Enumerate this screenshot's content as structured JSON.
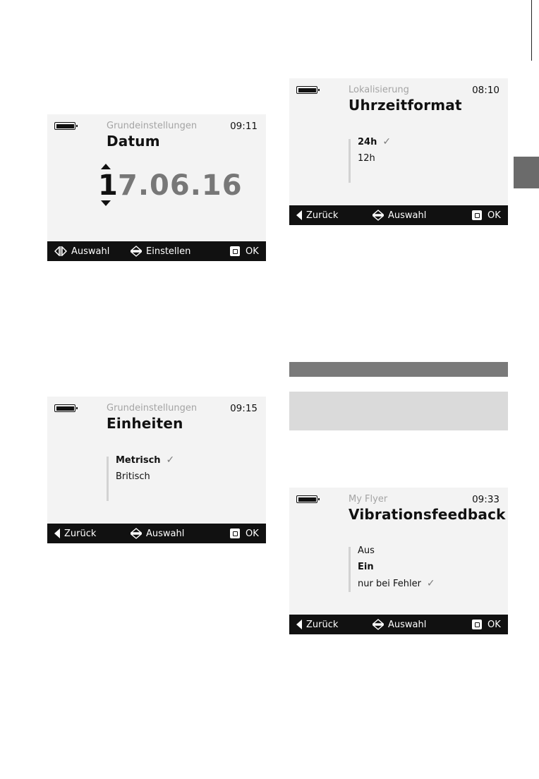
{
  "screens": [
    {
      "context": "Grundeinstellungen",
      "time": "09:11",
      "title": "Datum",
      "date": {
        "active_digit": "1",
        "rest": "7.06.16"
      },
      "footer": {
        "left": "Auswahl",
        "center": "Einstellen",
        "right": "OK"
      }
    },
    {
      "context": "Lokalisierung",
      "time": "08:10",
      "title": "Uhrzeitformat",
      "options": [
        {
          "label": "24h",
          "selected": true,
          "checked": true
        },
        {
          "label": "12h",
          "selected": false,
          "checked": false
        }
      ],
      "footer": {
        "left": "Zurück",
        "center": "Auswahl",
        "right": "OK"
      }
    },
    {
      "context": "Grundeinstellungen",
      "time": "09:15",
      "title": "Einheiten",
      "options": [
        {
          "label": "Metrisch",
          "selected": true,
          "checked": true
        },
        {
          "label": "Britisch",
          "selected": false,
          "checked": false
        }
      ],
      "footer": {
        "left": "Zurück",
        "center": "Auswahl",
        "right": "OK"
      }
    },
    {
      "context": "My Flyer",
      "time": "09:33",
      "title": "Vibrationsfeedback",
      "options": [
        {
          "label": "Aus",
          "selected": false,
          "checked": false
        },
        {
          "label": "Ein",
          "selected": true,
          "checked": false
        },
        {
          "label": "nur bei Fehler",
          "selected": false,
          "checked": true
        }
      ],
      "footer": {
        "left": "Zurück",
        "center": "Auswahl",
        "right": "OK"
      }
    }
  ],
  "icons": {
    "check": "✓",
    "battery": "battery-full-icon",
    "left_right": "left-right-arrows-icon",
    "up_down": "up-down-arrows-icon",
    "back": "back-triangle-icon",
    "ok": "ok-button-icon"
  },
  "colors": {
    "screen_bg": "#f3f3f3",
    "footer_bg": "#111111",
    "context_text": "#a4a4a4",
    "inactive_date": "#777777",
    "banner_dark": "#7a7a7a",
    "banner_light": "#dadada",
    "side_tab": "#6b6b6b"
  }
}
